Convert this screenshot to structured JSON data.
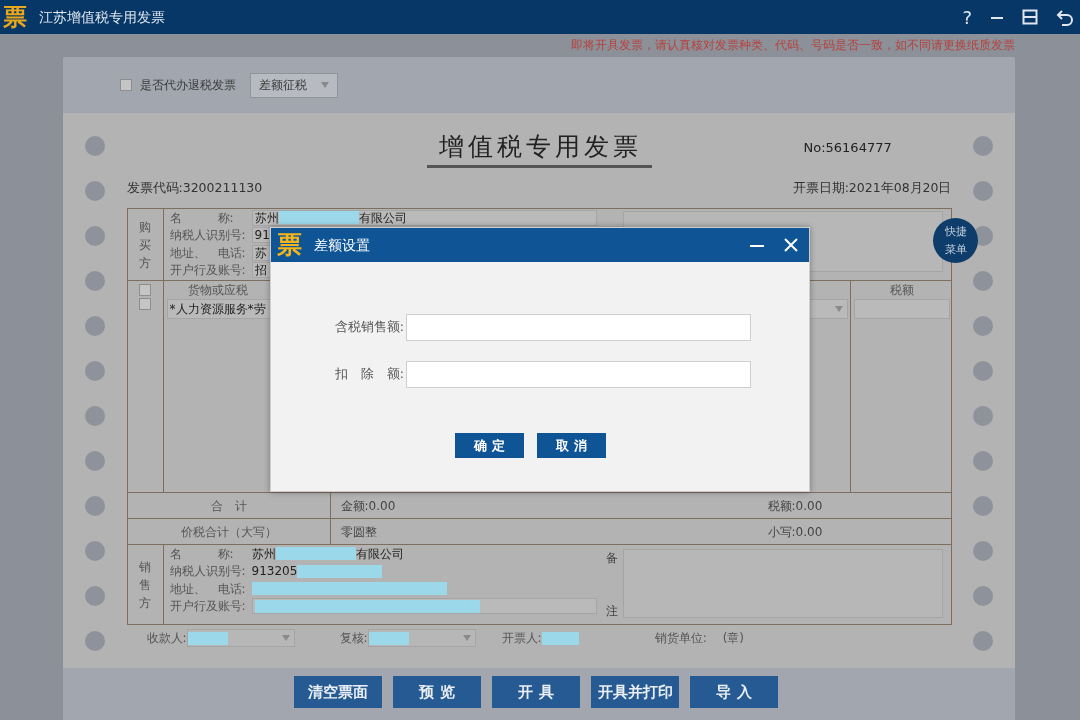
{
  "window": {
    "logo": "票",
    "title": "江苏增值税专用发票",
    "help": "?"
  },
  "notice": "即将开具发票，请认真核对发票种类、代码、号码是否一致，如不同请更换纸质发票",
  "toolbar": {
    "refund_checkbox": {
      "label": "是否代办退税发票",
      "checked": false
    },
    "tax_mode": "差额征税"
  },
  "invoice": {
    "title": "增值税专用发票",
    "number": "No:56164777",
    "code": "发票代码:3200211130",
    "date": "开票日期:2021年08月20日",
    "buyer": {
      "side_label": "购买方",
      "fields": [
        {
          "label": "名　　　称:",
          "kind": "field",
          "prefix": "苏州",
          "suffix": "有限公司",
          "redacted": true
        },
        {
          "label": "纳税人识别号:",
          "kind": "field",
          "prefix": "91"
        },
        {
          "label": "地址、　电话:",
          "kind": "field",
          "prefix": "苏"
        },
        {
          "label": "开户行及账号:",
          "kind": "field",
          "prefix": "招"
        }
      ]
    },
    "goods": {
      "name_header": "货物或应税",
      "tax_header": "税额",
      "rows": [
        {
          "checked": false,
          "name": "*人力资源服务*劳",
          "rate_select": true
        },
        {
          "checked": false
        }
      ]
    },
    "totals": [
      {
        "label": "合　计",
        "middle": "金额:0.00",
        "right": "税额:0.00"
      },
      {
        "label": "价税合计（大写）",
        "middle": "零圆整",
        "right": "小写:0.00"
      }
    ],
    "seller": {
      "side_label": "销售方",
      "fields": [
        {
          "label": "名　　　称:",
          "kind": "text",
          "prefix": "苏州",
          "suffix": "有限公司",
          "redacted": true
        },
        {
          "label": "纳税人识别号:",
          "kind": "text",
          "prefix": "913205",
          "redacted": true
        },
        {
          "label": "地址、　电话:",
          "kind": "text",
          "redacted": true
        },
        {
          "label": "开户行及账号:",
          "kind": "field",
          "redacted": true
        }
      ],
      "remark_top": "备",
      "remark_bottom": "注"
    },
    "footer": [
      {
        "label": "收款人:",
        "kind": "select",
        "redacted": true
      },
      {
        "label": "复核:",
        "kind": "select",
        "redacted": true
      },
      {
        "label": "开票人:",
        "kind": "text",
        "redacted": true
      },
      {
        "label": "销货单位:",
        "kind": "text",
        "value": "(章)"
      }
    ]
  },
  "quick_menu": "快捷菜单",
  "actions": [
    "清空票面",
    "预 览",
    "开 具",
    "开具并打印",
    "导 入"
  ],
  "dialog": {
    "logo": "票",
    "title": "差额设置",
    "fields": [
      {
        "label": "含税销售额:"
      },
      {
        "label": "扣　除　额:"
      }
    ],
    "buttons": [
      "确 定",
      "取 消"
    ]
  }
}
